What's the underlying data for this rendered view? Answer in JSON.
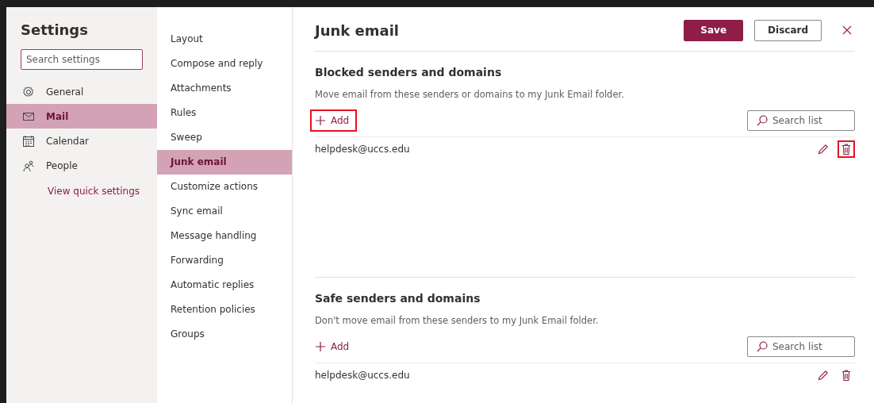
{
  "sidebar": {
    "title": "Settings",
    "search": {
      "placeholder": "Search settings"
    },
    "items": [
      {
        "label": "General",
        "kind": "gear",
        "selected": false
      },
      {
        "label": "Mail",
        "kind": "mail",
        "selected": true
      },
      {
        "label": "Calendar",
        "kind": "calendar",
        "selected": false
      },
      {
        "label": "People",
        "kind": "people",
        "selected": false
      }
    ],
    "link": "View quick settings"
  },
  "nav": {
    "items": [
      {
        "label": "Layout",
        "selected": false
      },
      {
        "label": "Compose and reply",
        "selected": false
      },
      {
        "label": "Attachments",
        "selected": false
      },
      {
        "label": "Rules",
        "selected": false
      },
      {
        "label": "Sweep",
        "selected": false
      },
      {
        "label": "Junk email",
        "selected": true
      },
      {
        "label": "Customize actions",
        "selected": false
      },
      {
        "label": "Sync email",
        "selected": false
      },
      {
        "label": "Message handling",
        "selected": false
      },
      {
        "label": "Forwarding",
        "selected": false
      },
      {
        "label": "Automatic replies",
        "selected": false
      },
      {
        "label": "Retention policies",
        "selected": false
      },
      {
        "label": "Groups",
        "selected": false
      }
    ]
  },
  "main": {
    "title": "Junk email",
    "buttons": [
      {
        "label": "Save",
        "kind": "primary"
      },
      {
        "label": "Discard",
        "kind": "secondary"
      }
    ],
    "sections": [
      {
        "title": "Blocked senders and domains",
        "description": "Move email from these senders or domains to my Junk Email folder.",
        "add": {
          "label": "Add",
          "highlighted": true
        },
        "search": {
          "placeholder": "Search list"
        },
        "rows": [
          {
            "address": "helpdesk@uccs.edu",
            "delete_highlighted": true
          }
        ]
      },
      {
        "title": "Safe senders and domains",
        "description": "Don't move email from these senders to my Junk Email folder.",
        "add": {
          "label": "Add",
          "highlighted": false
        },
        "search": {
          "placeholder": "Search list"
        },
        "rows": [
          {
            "address": "helpdesk@uccs.edu",
            "delete_highlighted": false
          }
        ]
      }
    ]
  }
}
